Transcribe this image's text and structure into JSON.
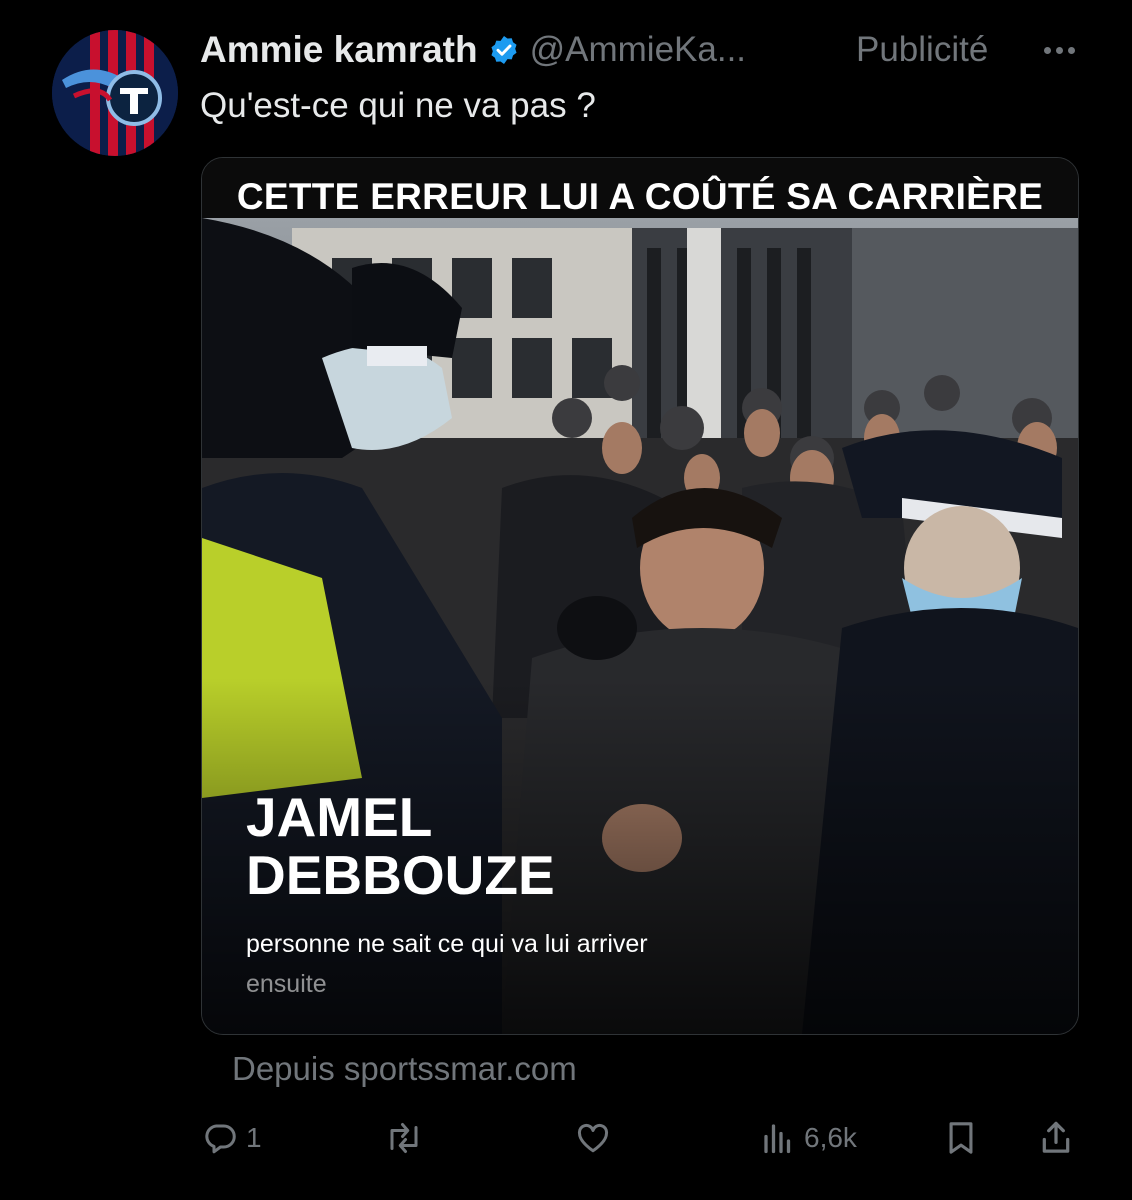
{
  "author": {
    "display_name": "Ammie kamrath",
    "handle": "@AmmieKa...",
    "promoted_label": "Publicité"
  },
  "tweet": {
    "text": "Qu'est-ce qui ne va pas ?"
  },
  "media": {
    "banner": "CETTE ERREUR LUI A COÛTÉ SA CARRIÈRE",
    "name_line1": "JAMEL",
    "name_line2": "DEBBOUZE",
    "subtitle_line1": "personne ne sait ce qui va lui arriver",
    "subtitle_line2": "ensuite"
  },
  "source": {
    "text": "Depuis sportssmar.com"
  },
  "actions": {
    "reply_count": "1",
    "views_count": "6,6k"
  },
  "colors": {
    "background": "#000000",
    "text_primary": "#e7e9ea",
    "text_secondary": "#71767b",
    "verified": "#1d9bf0"
  },
  "icons": [
    "more-icon",
    "verified-icon",
    "reply-icon",
    "retweet-icon",
    "like-icon",
    "views-icon",
    "bookmark-icon",
    "share-icon"
  ]
}
